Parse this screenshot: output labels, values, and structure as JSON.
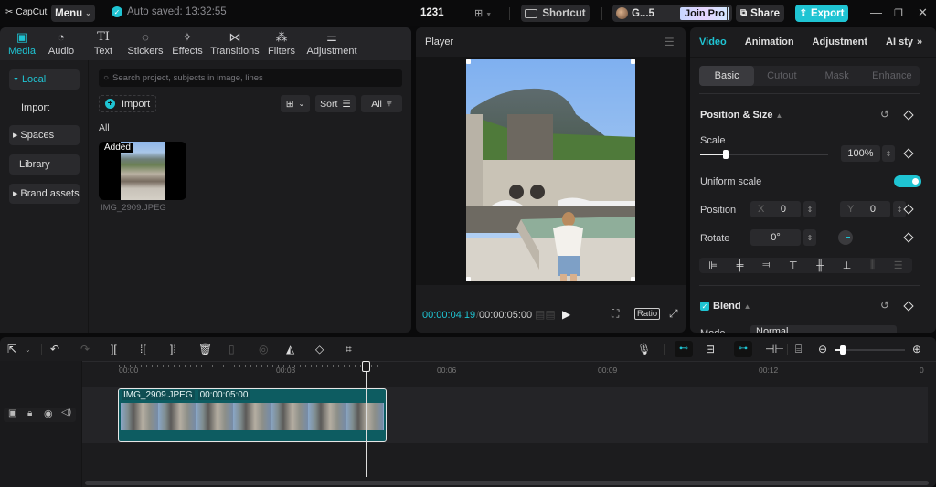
{
  "titlebar": {
    "app_name": "CapCut",
    "menu_label": "Menu",
    "autosave_text": "Auto saved: 13:32:55",
    "project_name": "1231",
    "shortcut_label": "Shortcut",
    "user_name": "G...5",
    "join_pro_label": "Join Pro",
    "share_label": "Share",
    "export_label": "Export",
    "accent_color": "#1fc4d3"
  },
  "media_panel": {
    "tabs": [
      {
        "label": "Media",
        "icon": "media-icon",
        "glyph": "▣",
        "active": true
      },
      {
        "label": "Audio",
        "icon": "audio-icon",
        "glyph": "◔",
        "active": false
      },
      {
        "label": "Text",
        "icon": "text-icon",
        "glyph": "TI",
        "active": false
      },
      {
        "label": "Stickers",
        "icon": "sticker-icon",
        "glyph": "◌",
        "active": false
      },
      {
        "label": "Effects",
        "icon": "effects-icon",
        "glyph": "✧",
        "active": false
      },
      {
        "label": "Transitions",
        "icon": "transitions-icon",
        "glyph": "⋈",
        "active": false
      },
      {
        "label": "Filters",
        "icon": "filters-icon",
        "glyph": "⁂",
        "active": false
      },
      {
        "label": "Adjustment",
        "icon": "adjustment-icon",
        "glyph": "⚌",
        "active": false
      }
    ],
    "sidebar": [
      {
        "label": "Local",
        "expanded": true,
        "active": true
      },
      {
        "label": "Import"
      },
      {
        "label": "Spaces",
        "expanded": false
      },
      {
        "label": "Library"
      },
      {
        "label": "Brand assets",
        "expanded": false
      }
    ],
    "search_placeholder": "Search project, subjects in image, lines",
    "import_label": "Import",
    "sort_label": "Sort",
    "filter_label": "All",
    "section_label": "All",
    "items": [
      {
        "name": "IMG_2909.JPEG",
        "badge": "Added"
      }
    ]
  },
  "player": {
    "title": "Player",
    "current_time": "00:00:04:19",
    "total_time": "00:00:05:00",
    "ratio_label": "Ratio"
  },
  "properties": {
    "tabs": [
      "Video",
      "Animation",
      "Adjustment",
      "AI sty"
    ],
    "active_tab": "Video",
    "subtabs": [
      "Basic",
      "Cutout",
      "Mask",
      "Enhance"
    ],
    "active_subtab": "Basic",
    "position_size": {
      "title": "Position & Size",
      "scale_label": "Scale",
      "scale_value": "100%",
      "scale_slider_fraction": 0.2,
      "uniform_scale_label": "Uniform scale",
      "uniform_scale_on": true,
      "position_label": "Position",
      "x_label": "X",
      "x_value": "0",
      "y_label": "Y",
      "y_value": "0",
      "rotate_label": "Rotate",
      "rotate_value": "0°"
    },
    "blend": {
      "title": "Blend",
      "checked": true,
      "mode_label": "Mode",
      "mode_value": "Normal"
    }
  },
  "timeline": {
    "ruler_labels": [
      "00:00",
      "00:03",
      "00:06",
      "00:09",
      "00:12",
      "0"
    ],
    "clip": {
      "name": "IMG_2909.JPEG",
      "duration": "00:00:05:00"
    },
    "zoom_fraction": 0.1
  }
}
